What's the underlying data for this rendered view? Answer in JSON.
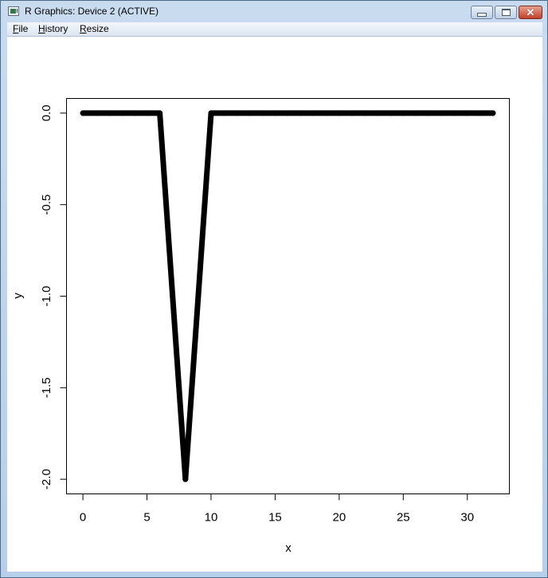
{
  "window": {
    "title": "R Graphics: Device 2 (ACTIVE)",
    "controls": {
      "minimize": "minimize",
      "maximize": "maximize",
      "close": "close"
    }
  },
  "menu": [
    {
      "label": "File",
      "accel": "F",
      "rest": "ile"
    },
    {
      "label": "History",
      "accel": "H",
      "rest": "istory"
    },
    {
      "label": "Resize",
      "accel": "R",
      "rest": "esize"
    }
  ],
  "chart_data": {
    "type": "line",
    "title": "",
    "xlabel": "x",
    "ylabel": "y",
    "x": [
      0,
      1,
      2,
      3,
      4,
      5,
      6,
      7,
      8,
      9,
      10,
      11,
      12,
      13,
      14,
      15,
      16,
      17,
      18,
      19,
      20,
      21,
      22,
      23,
      24,
      25,
      26,
      27,
      28,
      29,
      30,
      31,
      32
    ],
    "series": [
      {
        "name": "y",
        "color": "#000000",
        "values": [
          0,
          0,
          0,
          0,
          0,
          0,
          0,
          -1,
          -2,
          -1,
          0,
          0,
          0,
          0,
          0,
          0,
          0,
          0,
          0,
          0,
          0,
          0,
          0,
          0,
          0,
          0,
          0,
          0,
          0,
          0,
          0,
          0,
          0
        ]
      }
    ],
    "xlim": [
      -1.28,
      33.28
    ],
    "ylim": [
      -2.08,
      0.08
    ],
    "xticks": [
      0,
      5,
      10,
      15,
      20,
      25,
      30
    ],
    "xtick_labels": [
      "0",
      "5",
      "10",
      "15",
      "20",
      "25",
      "30"
    ],
    "yticks": [
      0,
      -0.5,
      -1,
      -1.5,
      -2
    ],
    "ytick_labels": [
      "0.0",
      "-0.5",
      "-1.0",
      "-1.5",
      "-2.0"
    ],
    "grid": false,
    "legend": "none"
  }
}
